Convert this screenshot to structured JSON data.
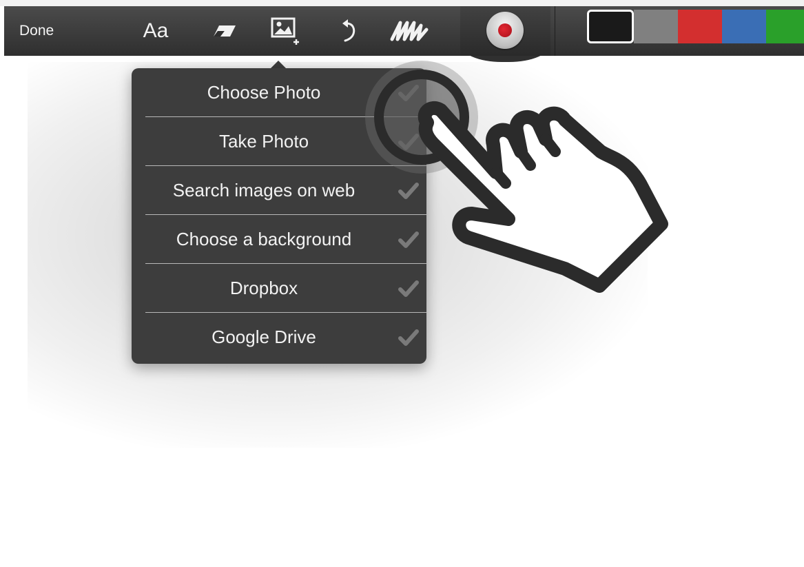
{
  "toolbar": {
    "done_label": "Done",
    "text_tool_label": "Aa",
    "tools": [
      "text-tool",
      "eraser-icon",
      "add-image-icon",
      "undo-icon",
      "scribble-icon"
    ],
    "record_icon": "record-icon"
  },
  "colors": {
    "toolbar_bg": "#3a3a3a",
    "popover_bg": "#3d3d3d",
    "record_red": "#c8141e",
    "swatches": [
      "#1a1a1a",
      "#808080",
      "#d32f2f",
      "#3a6eb5",
      "#2aa02a"
    ]
  },
  "image_menu": {
    "items": [
      {
        "label": "Choose Photo"
      },
      {
        "label": "Take Photo"
      },
      {
        "label": "Search images on web"
      },
      {
        "label": "Choose a background"
      },
      {
        "label": "Dropbox"
      },
      {
        "label": "Google Drive"
      }
    ],
    "item_icon": "checkmark-icon"
  },
  "overlay": {
    "icon": "pointing-hand-icon"
  }
}
